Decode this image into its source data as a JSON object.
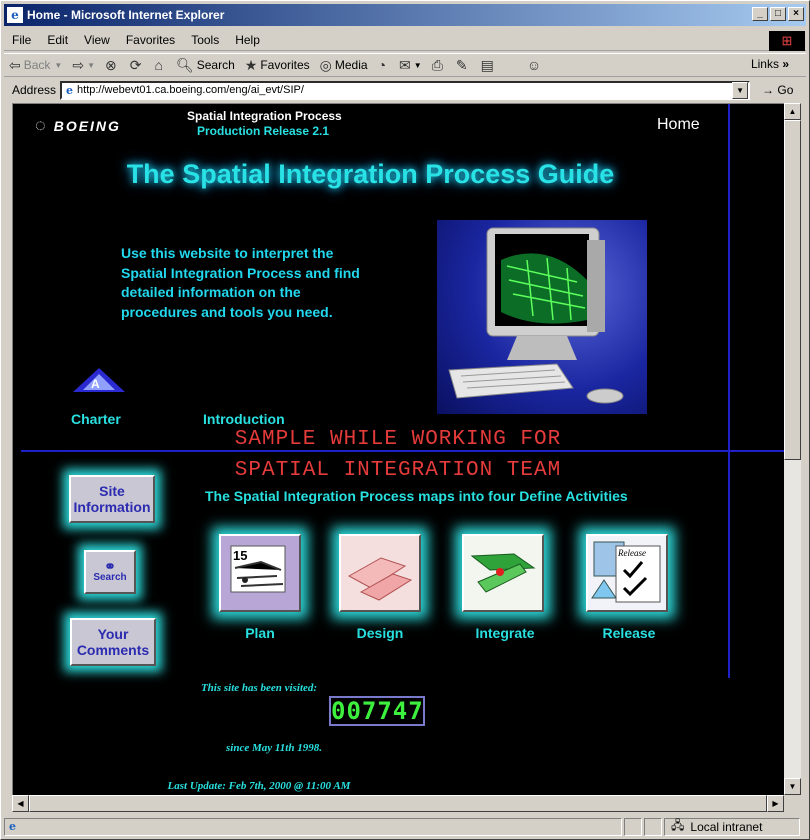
{
  "window": {
    "title": "Home - Microsoft Internet Explorer",
    "controls": [
      "_",
      "□",
      "×"
    ]
  },
  "menu": [
    "File",
    "Edit",
    "View",
    "Favorites",
    "Tools",
    "Help"
  ],
  "toolbar": {
    "back": "Back",
    "search": "Search",
    "favorites": "Favorites",
    "media": "Media",
    "links": "Links"
  },
  "address": {
    "label": "Address",
    "url": "http://webevt01.ca.boeing.com/eng/ai_evt/SIP/",
    "go": "Go"
  },
  "status": {
    "zone": "Local intranet"
  },
  "page": {
    "logo": "BOEING",
    "header_title": "Spatial Integration Process",
    "header_release": "Production Release 2.1",
    "home": "Home",
    "guide_title": "The Spatial Integration Process Guide",
    "intro": "Use this website to interpret the Spatial Integration Process and find detailed information on the procedures and tools you need.",
    "charter": "Charter",
    "introduction": "Introduction",
    "watermark_line1": "SAMPLE WHILE WORKING FOR",
    "watermark_line2": "SPATIAL INTEGRATION TEAM",
    "maps_text": "The Spatial Integration Process maps into four Define Activities",
    "site_info": "Site Information",
    "search": "Search",
    "comments": "Your Comments",
    "activities": [
      {
        "label": "Plan",
        "icon": "plan-icon"
      },
      {
        "label": "Design",
        "icon": "design-icon"
      },
      {
        "label": "Integrate",
        "icon": "integrate-icon"
      },
      {
        "label": "Release",
        "icon": "release-icon"
      }
    ],
    "visited_label": "This site has been visited:",
    "counter": "007747",
    "since": "since May 11th 1998.",
    "last_update": "Last Update: Feb 7th, 2000 @ 11:00 AM"
  }
}
